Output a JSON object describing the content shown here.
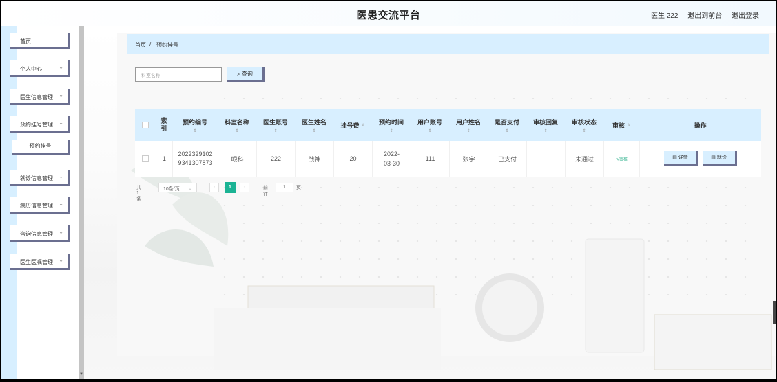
{
  "header": {
    "title": "医患交流平台",
    "user": "医生 222",
    "back_to_front": "退出到前台",
    "logout": "退出登录"
  },
  "sidebar": {
    "items": [
      {
        "label": "首页",
        "has_chevron": false
      },
      {
        "label": "个人中心",
        "has_chevron": true
      },
      {
        "label": "医生信息管理",
        "has_chevron": true
      },
      {
        "label": "预约挂号管理",
        "has_chevron": true
      },
      {
        "label": "就诊信息管理",
        "has_chevron": true
      },
      {
        "label": "病历信息管理",
        "has_chevron": true
      },
      {
        "label": "咨询信息管理",
        "has_chevron": true
      },
      {
        "label": "医生医嘱管理",
        "has_chevron": true
      }
    ],
    "sub_item": "预约挂号"
  },
  "breadcrumb": {
    "home": "首页",
    "separator": "/",
    "current": "预约挂号"
  },
  "search": {
    "placeholder": "科室名称",
    "button_label": "查询"
  },
  "table": {
    "headers": [
      "索引",
      "预约编号",
      "科室名称",
      "医生账号",
      "医生姓名",
      "挂号费",
      "预约时间",
      "用户账号",
      "用户姓名",
      "是否支付",
      "审核回复",
      "审核状态",
      "审核",
      "操作"
    ],
    "rows": [
      {
        "index": "1",
        "booking_no": "20223291029341307873",
        "department": "眼科",
        "doctor_account": "222",
        "doctor_name": "战神",
        "fee": "20",
        "booking_time": "2022-03-30",
        "user_account": "111",
        "user_name": "张宇",
        "paid": "已支付",
        "audit_reply": "",
        "audit_status": "未通过",
        "audit_link": "审核",
        "detail_label": "详情",
        "visit_label": "就诊"
      }
    ]
  },
  "pager": {
    "total": "共 1 条",
    "page_size": "10条/页",
    "prev": "‹",
    "current_page": "1",
    "next": "›",
    "goto_label": "前往",
    "goto_value": "1",
    "page_unit": "页"
  },
  "colors": {
    "accent_light": "#d8efff",
    "button_shadow": "#6b6f90",
    "active_page": "#1bb394"
  }
}
